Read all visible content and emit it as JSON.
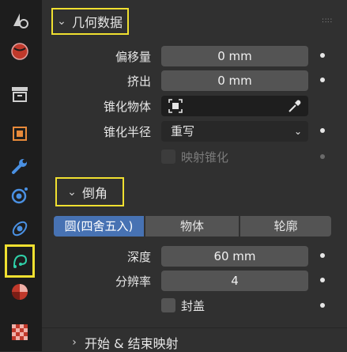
{
  "tabs": [
    {
      "icon": "tool-icon"
    },
    {
      "icon": "render-globe-icon"
    },
    {
      "icon": "output-icon"
    },
    {
      "icon": "object-icon"
    },
    {
      "icon": "modifier-wrench-icon"
    },
    {
      "icon": "particles-icon"
    },
    {
      "icon": "physics-icon"
    },
    {
      "icon": "curve-data-icon",
      "highlighted": true
    },
    {
      "icon": "material-icon"
    },
    {
      "icon": "texture-icon"
    }
  ],
  "geometry": {
    "title": "几何数据",
    "offset_label": "偏移量",
    "offset_value": "0 mm",
    "extrude_label": "挤出",
    "extrude_value": "0 mm",
    "taper_obj_label": "锥化物体",
    "taper_radius_label": "锥化半径",
    "taper_radius_value": "重写",
    "map_taper_label": "映射锥化"
  },
  "bevel": {
    "title": "倒角",
    "modes": [
      "圆(四舍五入)",
      "物体",
      "轮廓"
    ],
    "active_mode": 0,
    "depth_label": "深度",
    "depth_value": "60 mm",
    "resolution_label": "分辨率",
    "resolution_value": "4",
    "fill_caps_label": "封盖"
  },
  "start_end": {
    "title": "开始 & 结束映射"
  },
  "colors": {
    "highlight": "#f0e030",
    "active_tab": "#4772b3"
  }
}
